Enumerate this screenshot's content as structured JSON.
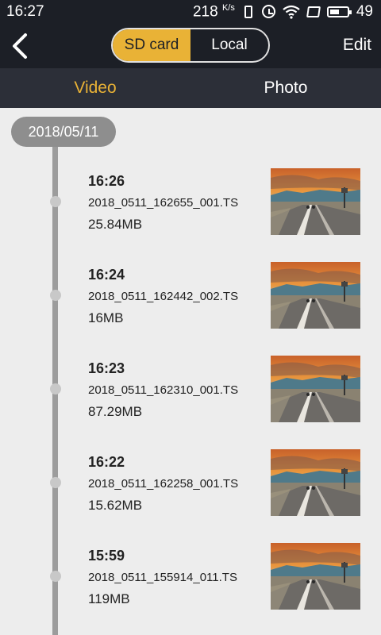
{
  "status_bar": {
    "time": "16:27",
    "speed": "218",
    "speed_unit": "K/s",
    "battery": "49"
  },
  "header": {
    "segments": [
      "SD card",
      "Local"
    ],
    "active_segment": "SD card",
    "edit_label": "Edit"
  },
  "tabs": [
    {
      "label": "Video",
      "active": true
    },
    {
      "label": "Photo",
      "active": false
    }
  ],
  "date_group": "2018/05/11",
  "videos": [
    {
      "time": "16:26",
      "name": "2018_0511_162655_001.TS",
      "size": "25.84MB"
    },
    {
      "time": "16:24",
      "name": "2018_0511_162442_002.TS",
      "size": "16MB"
    },
    {
      "time": "16:23",
      "name": "2018_0511_162310_001.TS",
      "size": "87.29MB"
    },
    {
      "time": "16:22",
      "name": "2018_0511_162258_001.TS",
      "size": "15.62MB"
    },
    {
      "time": "15:59",
      "name": "2018_0511_155914_011.TS",
      "size": "119MB"
    }
  ],
  "colors": {
    "accent": "#e9b236",
    "header_bg": "#1c1f26",
    "tab_bg": "#2c2f38",
    "timeline": "#9c9c9c"
  }
}
